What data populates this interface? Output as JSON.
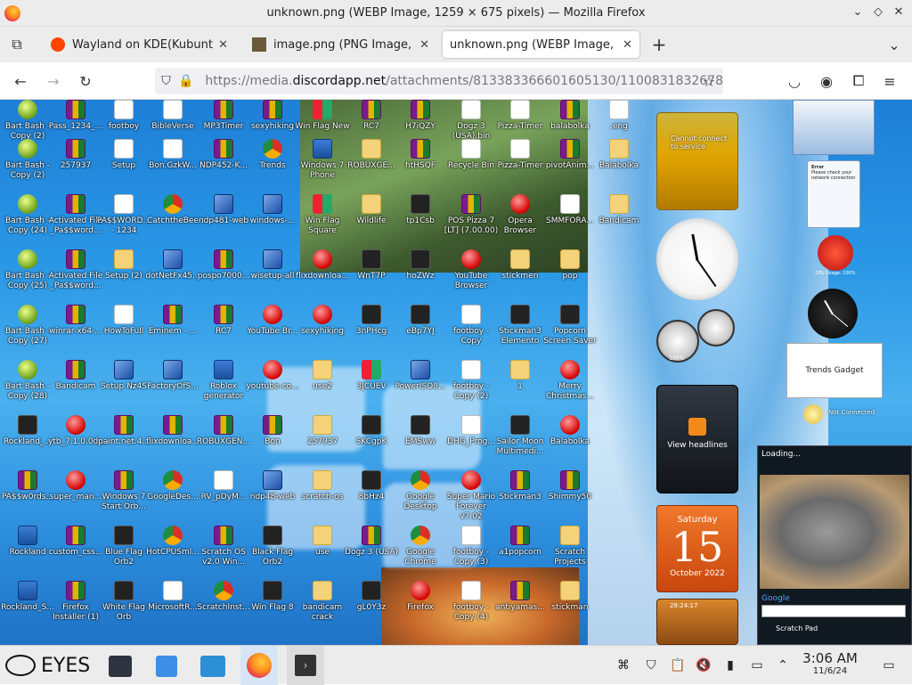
{
  "window": {
    "title": "unknown.png (WEBP Image, 1259 × 675 pixels) — Mozilla Firefox"
  },
  "tabs": [
    {
      "label": "Wayland on KDE(Kubuntu",
      "active": false
    },
    {
      "label": "image.png (PNG Image, 8(",
      "active": false
    },
    {
      "label": "unknown.png (WEBP Image,",
      "active": true
    }
  ],
  "url": {
    "prefix": "https://media.",
    "domain": "discordapp.net",
    "path": "/attachments/813383366601605130/1100831832678"
  },
  "desktop_icons": [
    {
      "label": "Bart Bash - Copy (2)",
      "kind": "ball"
    },
    {
      "label": "Pass_1234_...",
      "kind": "rar"
    },
    {
      "label": "footboy",
      "kind": "doc"
    },
    {
      "label": "BibleVerse",
      "kind": "doc"
    },
    {
      "label": "MP3Timer",
      "kind": "rar"
    },
    {
      "label": "sexyhiking",
      "kind": "rar"
    },
    {
      "label": "Win Flag New",
      "kind": "flag"
    },
    {
      "label": "RC7",
      "kind": "rar"
    },
    {
      "label": "H7iQZY",
      "kind": "rar"
    },
    {
      "label": "Dogz 3 (USA).bin",
      "kind": "doc"
    },
    {
      "label": "Pizza-Timer",
      "kind": "doc"
    },
    {
      "label": "balabolka",
      "kind": "rar"
    },
    {
      "label": ".eng",
      "kind": "doc"
    },
    {
      "label": "Bart Bash - Copy (2)",
      "kind": "ball"
    },
    {
      "label": "257937",
      "kind": "rar"
    },
    {
      "label": "Setup",
      "kind": "doc"
    },
    {
      "label": "Bon.GzkW...",
      "kind": "doc"
    },
    {
      "label": "NDP452-K...",
      "kind": "rar"
    },
    {
      "label": "Trends",
      "kind": "chrome"
    },
    {
      "label": "Windows 7 Phone",
      "kind": "win"
    },
    {
      "label": "ROBUXGE...",
      "kind": "fold"
    },
    {
      "label": "htHSQF",
      "kind": "rar"
    },
    {
      "label": "Recycle Bin",
      "kind": "doc"
    },
    {
      "label": "Pizza-Timer",
      "kind": "doc"
    },
    {
      "label": "pivotAnim...",
      "kind": "rar"
    },
    {
      "label": "Balabolka",
      "kind": "fold"
    },
    {
      "label": "Bart Bash - Copy (24)",
      "kind": "ball"
    },
    {
      "label": "Activated File _Pa$$word...",
      "kind": "rar"
    },
    {
      "label": "PA$$WORD... - 1234",
      "kind": "doc"
    },
    {
      "label": "CatchtheBee",
      "kind": "chrome"
    },
    {
      "label": "ndp481-web",
      "kind": "inst"
    },
    {
      "label": "windows-...",
      "kind": "inst"
    },
    {
      "label": "Win Flag Square",
      "kind": "flag"
    },
    {
      "label": "Wildlife",
      "kind": "fold"
    },
    {
      "label": "tp1Csb",
      "kind": "blk"
    },
    {
      "label": "POS Pizza 7 [LT] (7.00.00)",
      "kind": "rar"
    },
    {
      "label": "Opera Browser",
      "kind": "red"
    },
    {
      "label": "SMMFORA...",
      "kind": "doc"
    },
    {
      "label": "Bandicam",
      "kind": "fold"
    },
    {
      "label": "Bart Bash - Copy (25)",
      "kind": "ball"
    },
    {
      "label": "Activated File _Pa$$word...",
      "kind": "rar"
    },
    {
      "label": "Setup (2)",
      "kind": "fold"
    },
    {
      "label": "dotNetFx45...",
      "kind": "inst"
    },
    {
      "label": "pospo7000...",
      "kind": "rar"
    },
    {
      "label": "wisetup-all",
      "kind": "inst"
    },
    {
      "label": "flixdownloa...",
      "kind": "red"
    },
    {
      "label": "WnT7P",
      "kind": "blk"
    },
    {
      "label": "hoZWz",
      "kind": "blk"
    },
    {
      "label": "YouTube Browser",
      "kind": "red"
    },
    {
      "label": "stickmen",
      "kind": "fold"
    },
    {
      "label": "pop",
      "kind": "fold"
    },
    {
      "label": "Bart Bash - Copy (27)",
      "kind": "ball"
    },
    {
      "label": "winrar-x64-...",
      "kind": "rar"
    },
    {
      "label": "HowToFull",
      "kind": "doc"
    },
    {
      "label": "Eminem - ...",
      "kind": "rar"
    },
    {
      "label": "RC7",
      "kind": "rar"
    },
    {
      "label": "YouTube Br...",
      "kind": "red"
    },
    {
      "label": "sexyhiking",
      "kind": "red"
    },
    {
      "label": "3nPHcg",
      "kind": "blk"
    },
    {
      "label": "eBp7YJ",
      "kind": "blk"
    },
    {
      "label": "footboy - Copy",
      "kind": "doc"
    },
    {
      "label": "Stickman3 Elemento",
      "kind": "blk"
    },
    {
      "label": "Popcorn Screen Saver",
      "kind": "blk"
    },
    {
      "label": "Bart Bash - Copy (28)",
      "kind": "ball"
    },
    {
      "label": "Bandicam",
      "kind": "rar"
    },
    {
      "label": "Setup Nz4S",
      "kind": "inst"
    },
    {
      "label": "FactoryOfS...",
      "kind": "inst"
    },
    {
      "label": "Roblox generator",
      "kind": "win"
    },
    {
      "label": "youtube-co...",
      "kind": "red"
    },
    {
      "label": "use2",
      "kind": "fold"
    },
    {
      "label": "3JCUEV",
      "kind": "flag"
    },
    {
      "label": "PowerISO8...",
      "kind": "inst"
    },
    {
      "label": "footboy - Copy (2)",
      "kind": "doc"
    },
    {
      "label": "1",
      "kind": "fold"
    },
    {
      "label": "Merry Christmas...",
      "kind": "red"
    },
    {
      "label": "Rockland_...",
      "kind": "blk"
    },
    {
      "label": "ytb_7.1.0.0d...",
      "kind": "red"
    },
    {
      "label": "paint.net.4...",
      "kind": "rar"
    },
    {
      "label": "flixdownloa...",
      "kind": "rar"
    },
    {
      "label": "ROBUXGEN...",
      "kind": "rar"
    },
    {
      "label": "Bon",
      "kind": "rar"
    },
    {
      "label": "257937",
      "kind": "fold"
    },
    {
      "label": "SKCgpK",
      "kind": "blk"
    },
    {
      "label": "EMSww",
      "kind": "blk"
    },
    {
      "label": "DHG_Prog...",
      "kind": "doc"
    },
    {
      "label": "Sailor Moon Multimedi...",
      "kind": "blk"
    },
    {
      "label": "Balabolka",
      "kind": "red"
    },
    {
      "label": "PA$$w0rds...",
      "kind": "rar"
    },
    {
      "label": "super_man...",
      "kind": "red"
    },
    {
      "label": "Windows 7 Start Orb...",
      "kind": "rar"
    },
    {
      "label": "GoogleDes...",
      "kind": "chrome"
    },
    {
      "label": "RV_pDyM...",
      "kind": "doc"
    },
    {
      "label": "ndp48-web",
      "kind": "inst"
    },
    {
      "label": "scratch-os",
      "kind": "fold"
    },
    {
      "label": "8bHz4",
      "kind": "blk"
    },
    {
      "label": "Google Desktop",
      "kind": "chrome"
    },
    {
      "label": "Super Mario Forever v7.02",
      "kind": "red"
    },
    {
      "label": "Stickman3",
      "kind": "rar"
    },
    {
      "label": "Shimmy50",
      "kind": "rar"
    },
    {
      "label": "Rockland",
      "kind": "win"
    },
    {
      "label": "custom_css...",
      "kind": "rar"
    },
    {
      "label": "Blue Flag Orb2",
      "kind": "blk"
    },
    {
      "label": "HotCPUSml...",
      "kind": "chrome"
    },
    {
      "label": "Scratch OS v2.0 Win...",
      "kind": "rar"
    },
    {
      "label": "Black Flag Orb2",
      "kind": "blk"
    },
    {
      "label": "use",
      "kind": "fold"
    },
    {
      "label": "Dogz 3 (USA)",
      "kind": "rar"
    },
    {
      "label": "Google Chrome",
      "kind": "chrome"
    },
    {
      "label": "footboy - Copy (3)",
      "kind": "doc"
    },
    {
      "label": "a1popcorn",
      "kind": "rar"
    },
    {
      "label": "Scratch Projects",
      "kind": "fold"
    },
    {
      "label": "Rockland_S...",
      "kind": "win"
    },
    {
      "label": "Firefox Installer (1)",
      "kind": "rar"
    },
    {
      "label": "White Flag Orb",
      "kind": "blk"
    },
    {
      "label": "MicrosoftR...",
      "kind": "doc"
    },
    {
      "label": "ScratchInst...",
      "kind": "chrome"
    },
    {
      "label": "Win Flag 8",
      "kind": "blk"
    },
    {
      "label": "bandicam crack",
      "kind": "fold"
    },
    {
      "label": "gL0Y3z",
      "kind": "blk"
    },
    {
      "label": "Firefox",
      "kind": "red"
    },
    {
      "label": "footboy - Copy (4)",
      "kind": "doc"
    },
    {
      "label": "antiyamas...",
      "kind": "rar"
    },
    {
      "label": "stickman",
      "kind": "fold"
    }
  ],
  "gadgets": {
    "weather_text": "Cannot connect to service",
    "headlines_text": "View headlines",
    "calendar": {
      "day": "Saturday",
      "date": "15",
      "month": "October 2022"
    },
    "trends_text": "Trends Gadget",
    "not_connected": "Not Connected",
    "loading": "Loading...",
    "scratch_pad": "Scratch Pad",
    "search_label": "Google",
    "cpu_label": "CPU Usage: 100%",
    "timer_text": "28:24:17",
    "error_title": "Error",
    "error_body": "Please check your network connection",
    "meter_pct": "100%"
  },
  "taskbar": {
    "brand": "EYES",
    "clock_time": "3:06 AM",
    "clock_date": "11/6/24"
  },
  "colors": {
    "accent": "#0060df",
    "desktop": "#2a97e6",
    "calendar": "#e05a12"
  }
}
